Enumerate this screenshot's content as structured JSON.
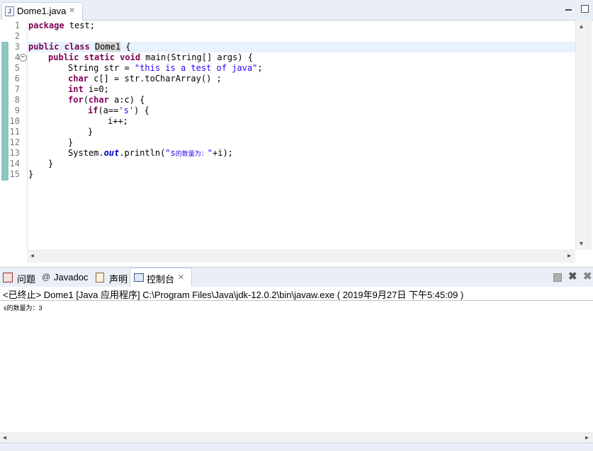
{
  "editor": {
    "tab_title": "Dome1.java",
    "file_icon_letter": "J",
    "lines": [
      "1",
      "2",
      "3",
      "4",
      "5",
      "6",
      "7",
      "8",
      "9",
      "10",
      "11",
      "12",
      "13",
      "14",
      "15"
    ],
    "code": {
      "l1_kw": "package",
      "l1_rest": " test;",
      "l3_kw": "public class",
      "l3_cls": "Dome1",
      "l3_rest": " {",
      "l4_kw": "public static void",
      "l4_rest": " main(String[] args) {",
      "l5_a": "String str = ",
      "l5_str": "\"this is a test of java\"",
      "l5_b": ";",
      "l6_kw": "char",
      "l6_rest": " c[] = str.toCharArray() ;",
      "l7_kw": "int",
      "l7_rest": " i=0;",
      "l8_kw": "for",
      "l8_a": "(",
      "l8_kw2": "char",
      "l8_rest": " a:c) {",
      "l9_kw": "if",
      "l9_a": "(a==",
      "l9_str": "'s'",
      "l9_rest": ") {",
      "l10": "i++;",
      "l11": "}",
      "l12": "}",
      "l13_a": "System.",
      "l13_out": "out",
      "l13_b": ".println(",
      "l13_q": "\"s",
      "l13_cjk": "的数量为：",
      "l13_q2": "\"",
      "l13_c": "+i);",
      "l14": "}",
      "l15": "}"
    }
  },
  "console_view": {
    "tabs": {
      "problems": "问题",
      "javadoc": "Javadoc",
      "declaration": "声明",
      "console": "控制台"
    },
    "status": "<已终止> Dome1 [Java 应用程序] C:\\Program Files\\Java\\jdk-12.0.2\\bin\\javaw.exe ( 2019年9月27日 下午5:45:09 )",
    "output": "s的数量为：3"
  },
  "colors": {
    "keyword": "#7f0055",
    "string": "#2a00ff",
    "static_field": "#0000c0",
    "current_line": "#e8f2fe",
    "tab_bar": "#e9eef7"
  }
}
